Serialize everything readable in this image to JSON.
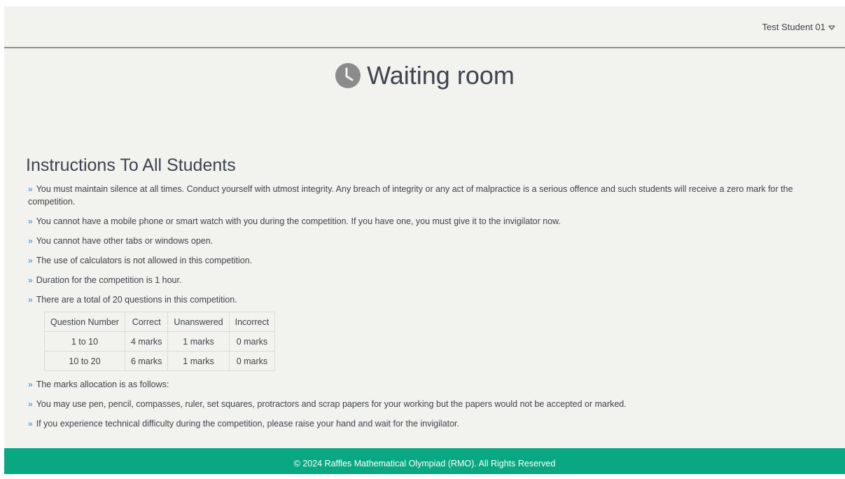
{
  "header": {
    "user_name": "Test Student 01",
    "caret_icon": "chevron-down-icon"
  },
  "page": {
    "title": "Waiting room",
    "title_icon": "clock-icon"
  },
  "instructions": {
    "title": "Instructions To All Students",
    "bullet_icon": "double-chevron-right-icon",
    "items_before_table": [
      "You must maintain silence at all times. Conduct yourself with utmost integrity. Any breach of integrity or any act of malpractice is a serious offence and such students will receive a zero mark for the competition.",
      "You cannot have a mobile phone or smart watch with you during the competition. If you have one, you must give it to the invigilator now.",
      "You cannot have other tabs or windows open.",
      "The use of calculators is not allowed in this competition.",
      "Duration for the competition is 1 hour.",
      "There are a total of 20 questions in this competition."
    ],
    "items_after_table": [
      "The marks allocation is as follows:",
      "You may use pen, pencil, compasses, ruler, set squares, protractors and scrap papers for your working but the papers would not be accepted or marked.",
      "If you experience technical difficulty during the competition, please raise your hand and wait for the invigilator."
    ]
  },
  "marks_table": {
    "headers": [
      "Question Number",
      "Correct",
      "Unanswered",
      "Incorrect"
    ],
    "rows": [
      [
        "1 to 10",
        "4 marks",
        "1 marks",
        "0 marks"
      ],
      [
        "10 to 20",
        "6 marks",
        "1 marks",
        "0 marks"
      ]
    ]
  },
  "footer": {
    "text": "© 2024 Raffles Mathematical Olympiad (RMO). All Rights Reserved"
  },
  "colors": {
    "background": "#f2f2ef",
    "accent_bullet": "#2d8cd6",
    "footer": "#0aa882",
    "clock_icon": "#8b8b8b"
  }
}
